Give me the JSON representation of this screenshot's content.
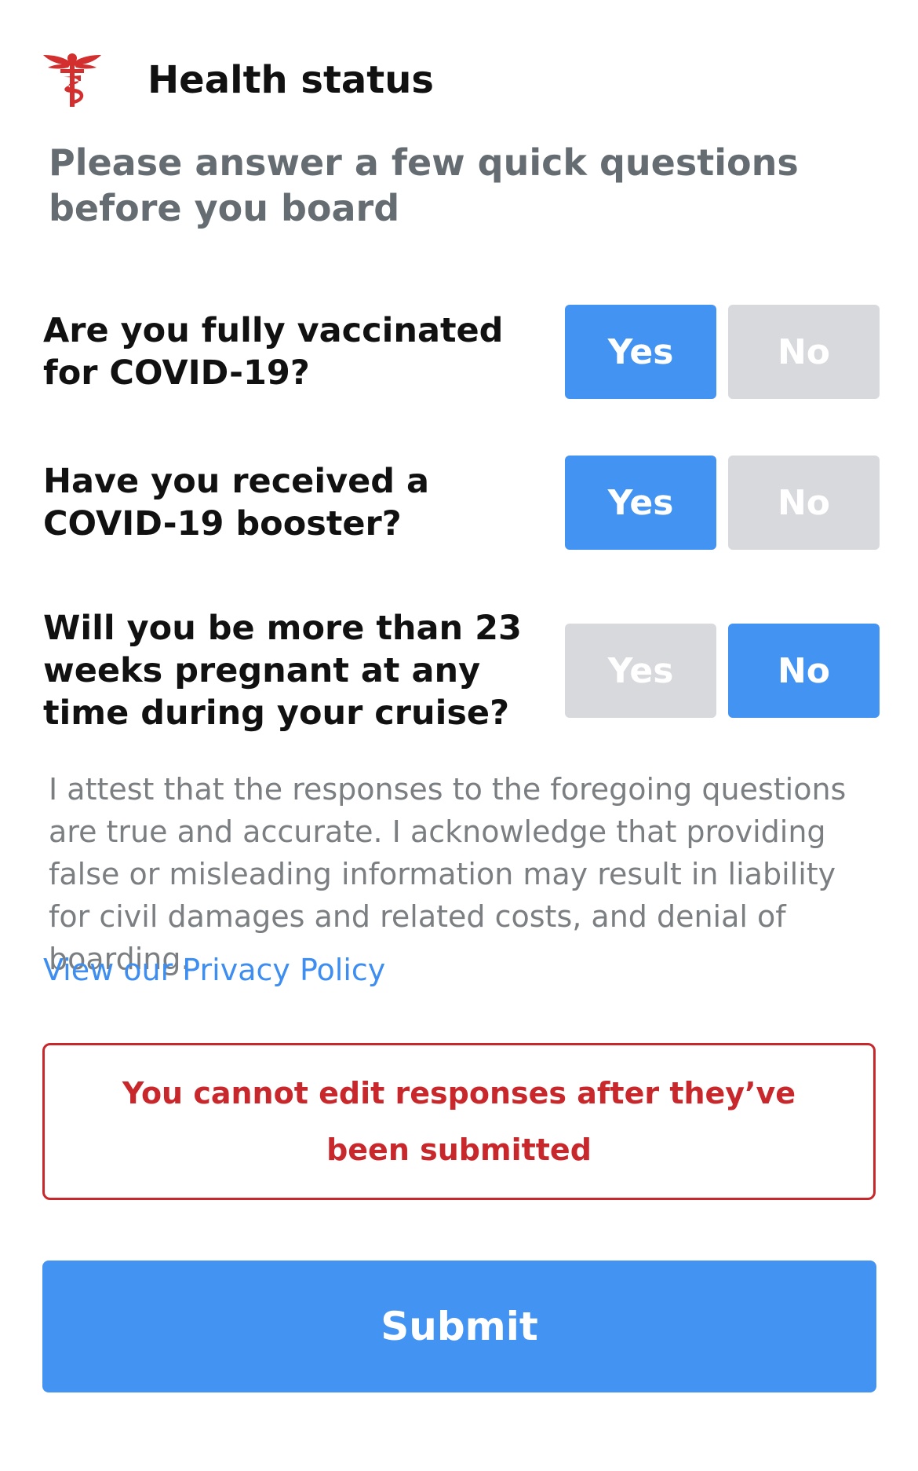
{
  "header": {
    "title": "Health status",
    "icon": "caduceus-icon",
    "icon_color": "#d32f2f"
  },
  "subtitle": "Please answer a few quick questions before you board",
  "questions": [
    {
      "text": "Are you fully vaccinated for COVID-19?",
      "yes_label": "Yes",
      "no_label": "No",
      "selected": "Yes"
    },
    {
      "text": "Have you received a COVID-19 booster?",
      "yes_label": "Yes",
      "no_label": "No",
      "selected": "Yes"
    },
    {
      "text": "Will you be more than 23 weeks pregnant at any time during your cruise?",
      "yes_label": "Yes",
      "no_label": "No",
      "selected": "No"
    }
  ],
  "attestation": "I attest that the responses to the foregoing questions are true and accurate. I acknowledge that providing false or misleading information may result in liability for civil damages and related costs, and denial of boarding.",
  "privacy_link": "View our Privacy Policy",
  "warning": "You cannot edit responses after they’ve been submitted",
  "submit_label": "Submit",
  "colors": {
    "accent": "#4393f2",
    "unselected": "#d8d9dc",
    "warning": "#c8282b",
    "link": "#3d8ef0"
  }
}
